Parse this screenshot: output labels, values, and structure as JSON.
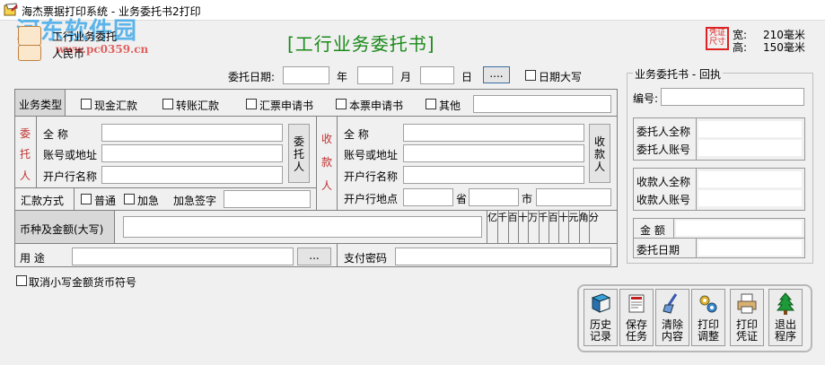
{
  "window": {
    "title": "海杰票据打印系统 - 业务委托书2打印"
  },
  "watermark": {
    "site": "河东软件园",
    "url": "www.pc0359.cn"
  },
  "left_top": {
    "template_name": "工行业务委托",
    "currency": "人民币"
  },
  "form_title": "[工行业务委托书]",
  "paper": {
    "icon_label": "凭证尺寸",
    "width_label": "宽:",
    "width_value": "210毫米",
    "height_label": "高:",
    "height_value": "150毫米"
  },
  "date_row": {
    "label": "委托日期:",
    "year": "年",
    "month": "月",
    "day": "日",
    "picker": "....",
    "uppercase_label": "日期大写"
  },
  "biz_type": {
    "label": "业务类型",
    "options": [
      "现金汇款",
      "转账汇款",
      "汇票申请书",
      "本票申请书",
      "其他"
    ]
  },
  "payer": {
    "side_label_chars": [
      "委",
      "托",
      "人"
    ],
    "fields": [
      "全      称",
      "账号或地址",
      "开户行名称"
    ],
    "button_chars": [
      "委",
      "托",
      "人"
    ]
  },
  "payee": {
    "side_label_chars": [
      "收",
      "款",
      "人"
    ],
    "fields": [
      "全      称",
      "账号或地址",
      "开户行名称",
      "开户行地点"
    ],
    "province": "省",
    "city": "市",
    "button_chars": [
      "收",
      "款",
      "人"
    ]
  },
  "remit": {
    "label": "汇款方式",
    "normal": "普通",
    "urgent": "加急",
    "urgent_sign": "加急签字"
  },
  "amount": {
    "label": "币种及金额(大写)",
    "digits": [
      "亿",
      "千",
      "百",
      "十",
      "万",
      "千",
      "百",
      "十",
      "元",
      "角",
      "分"
    ]
  },
  "purpose": {
    "label": "用    途",
    "more": "...",
    "password": "支付密码"
  },
  "cancel_symbol": "取消小写金额货币符号",
  "receipt": {
    "title": "业务委托书 - 回执",
    "number": "编号:",
    "payer_name": "委托人全称",
    "payer_account": "委托人账号",
    "payee_name": "收款人全称",
    "payee_account": "收款人账号",
    "amount": "金  额",
    "date": "委托日期"
  },
  "toolbar": [
    {
      "label1": "历史",
      "label2": "记录",
      "icon": "history-book-icon"
    },
    {
      "label1": "保存",
      "label2": "任务",
      "icon": "save-task-icon"
    },
    {
      "label1": "清除",
      "label2": "内容",
      "icon": "clear-broom-icon"
    },
    {
      "label1": "打印",
      "label2": "调整",
      "icon": "print-adjust-gear-icon"
    },
    {
      "label1": "打印",
      "label2": "凭证",
      "icon": "printer-icon"
    },
    {
      "label1": "退出",
      "label2": "程序",
      "icon": "exit-tree-icon"
    }
  ]
}
